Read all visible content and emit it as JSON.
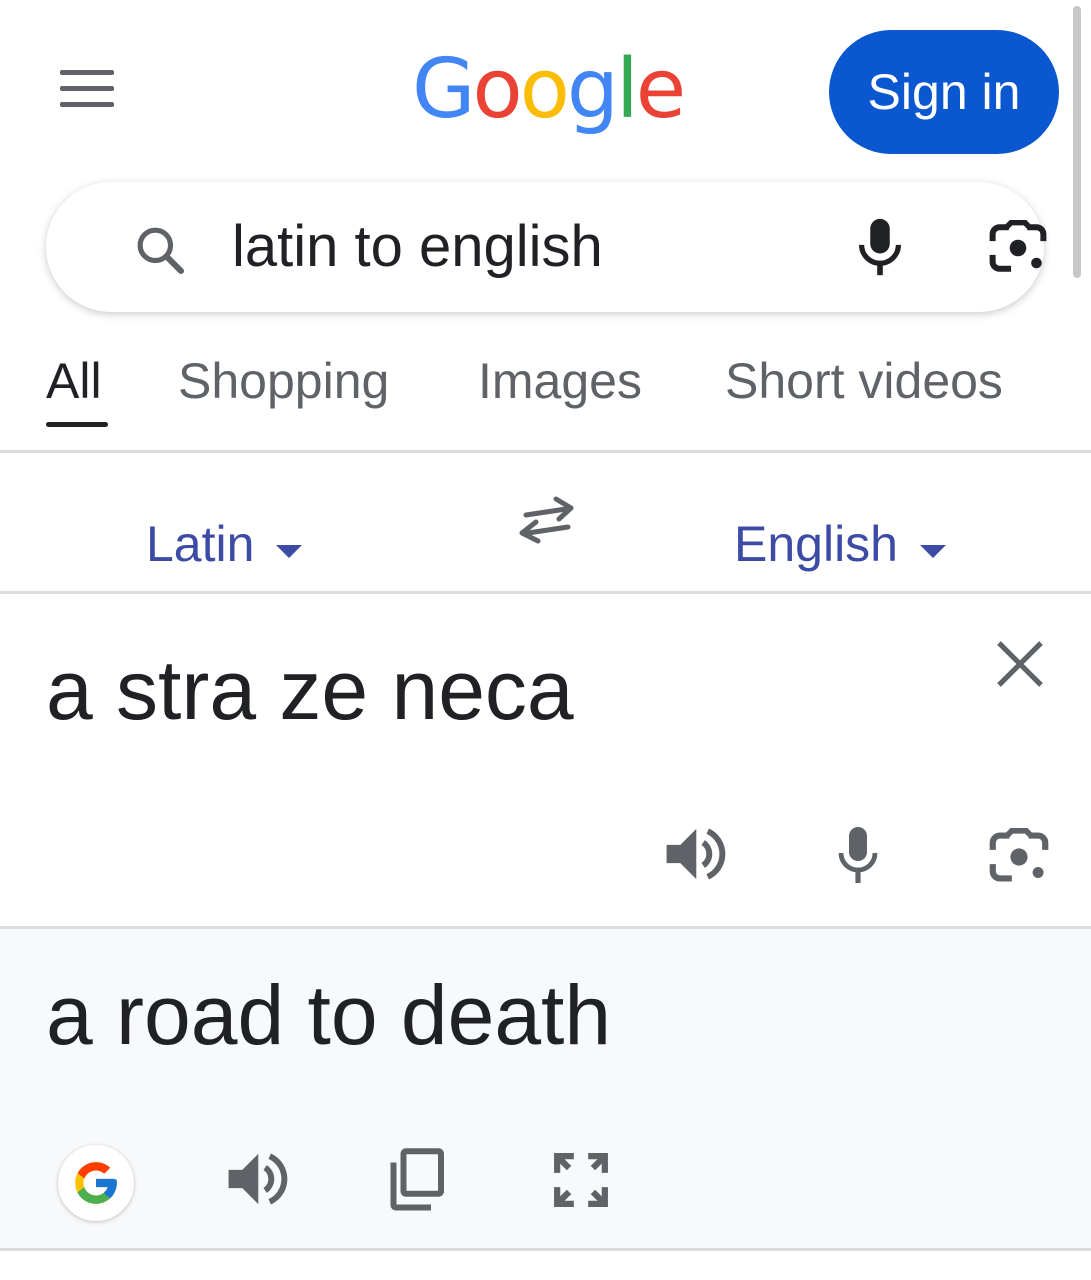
{
  "header": {
    "logo_letters": [
      {
        "char": "G",
        "color": "#4285f4"
      },
      {
        "char": "o",
        "color": "#ea4335"
      },
      {
        "char": "o",
        "color": "#fbbc05"
      },
      {
        "char": "g",
        "color": "#4285f4"
      },
      {
        "char": "l",
        "color": "#34a853"
      },
      {
        "char": "e",
        "color": "#ea4335"
      }
    ],
    "signin_label": "Sign in",
    "menu_icon": "hamburger-menu-icon"
  },
  "search": {
    "query": "latin to english",
    "icons": [
      "search-icon",
      "mic-icon",
      "lens-icon"
    ]
  },
  "tabs": [
    {
      "label": "All",
      "active": true
    },
    {
      "label": "Shopping",
      "active": false
    },
    {
      "label": "Images",
      "active": false
    },
    {
      "label": "Short videos",
      "active": false
    }
  ],
  "translator": {
    "source_language": "Latin",
    "target_language": "English",
    "source_text": "a stra ze neca",
    "translated_text": "a road to death",
    "source_icons": [
      "close-icon",
      "speaker-icon",
      "mic-icon",
      "lens-icon"
    ],
    "target_icons": [
      "google-g-icon",
      "speaker-icon",
      "copy-icon",
      "expand-icon"
    ]
  },
  "colors": {
    "accent": "#0b57d0",
    "language_link": "#3c4ba6",
    "icon_gray": "#5f6368",
    "text": "#202124"
  }
}
